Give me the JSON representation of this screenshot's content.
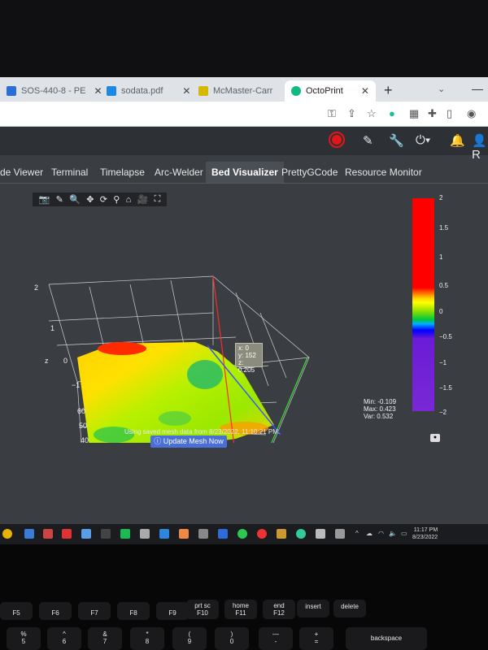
{
  "browser": {
    "tabs": [
      {
        "label": "SOS-440-8 - PE",
        "color": "#2b6fd6"
      },
      {
        "label": "sodata.pdf",
        "color": "#1e88e5"
      },
      {
        "label": "McMaster-Carr",
        "color": "#d5b800"
      },
      {
        "label": "OctoPrint",
        "color": "#11b980"
      }
    ],
    "new_tab": "+",
    "tab_menu": "⌄",
    "minimize": "—"
  },
  "toolbar": {
    "icons": [
      "key-icon",
      "share-icon",
      "star-icon",
      "grammarly-icon",
      "extension-icon",
      "puzzle-icon",
      "sidepanel-icon",
      "profile-icon"
    ]
  },
  "octoprint_nav": {
    "user_initial": "R"
  },
  "tabs": [
    "de Viewer",
    "Terminal",
    "Timelapse",
    "Arc-Welder",
    "Bed Visualizer",
    "PrettyGCode",
    "Resource Monitor"
  ],
  "active_tab": "Bed Visualizer",
  "plot": {
    "z_axis_label": "z",
    "x_axis_label": "x",
    "y_axis_label": "y",
    "z_ticks": [
      "2",
      "1",
      "0",
      "−1"
    ],
    "x_ticks": [
      "60",
      "50",
      "40",
      "30",
      "200",
      "100"
    ],
    "y_ticks": [
      "z",
      "10",
      "0"
    ],
    "tooltip": {
      "x": "x: 0",
      "y": "y: 152",
      "z": "z: 0.205"
    }
  },
  "colorbar": {
    "ticks": [
      "2",
      "1.5",
      "1",
      "0.5",
      "0",
      "−0.5",
      "−1",
      "−1.5",
      "−2"
    ],
    "colors": [
      "#ff0000",
      "#ffff00",
      "#00c83c",
      "#0000ff",
      "#7a28d6"
    ]
  },
  "stats": {
    "min": "Min: -0.109",
    "max": "Max: 0.423",
    "var": "Var: 0.532"
  },
  "mesh_note": "Using saved mesh data from 8/23/2022, 11:10:21 PM.",
  "update_button": "Update Mesh Now",
  "taskbar": {
    "time": "11:17 PM",
    "date": "8/23/2022"
  },
  "keyboard": {
    "fn_keys": [
      "F5",
      "F6",
      "F7",
      "F8",
      "F9",
      "prt sc",
      "home",
      "end",
      "insert",
      "delete"
    ],
    "fn_sub": [
      "F10",
      "F11",
      "F12"
    ],
    "num_keys": [
      "%",
      "^",
      "&",
      "*",
      "(",
      ")",
      "—",
      "+",
      "backspace"
    ],
    "num_sub": [
      "5",
      "6",
      "7",
      "8",
      "9",
      "0",
      "-",
      "="
    ]
  }
}
